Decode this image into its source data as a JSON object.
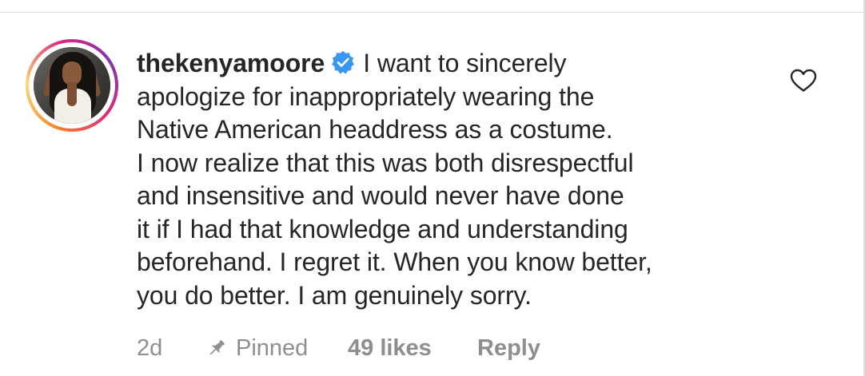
{
  "comment": {
    "username": "thekenyamoore",
    "verified": true,
    "text_lines": [
      "I want to sincerely",
      "apologize for inappropriately wearing the",
      "Native American headdress as a costume.",
      "I now realize that this was both disrespectful",
      "and insensitive and would never have done",
      "it if I had that knowledge and understanding",
      "beforehand.  I regret it.  When you know better,",
      "you do better. I am genuinely sorry."
    ],
    "timestamp": "2d",
    "pinned_label": "Pinned",
    "likes": "49 likes",
    "reply_label": "Reply"
  },
  "icons": {
    "verified": "verified-badge-icon",
    "like": "heart-icon",
    "pin": "pin-icon"
  },
  "colors": {
    "text": "#262626",
    "meta": "#8e8e8e",
    "verified_blue": "#3897f0",
    "divider": "#dbdbdb"
  }
}
